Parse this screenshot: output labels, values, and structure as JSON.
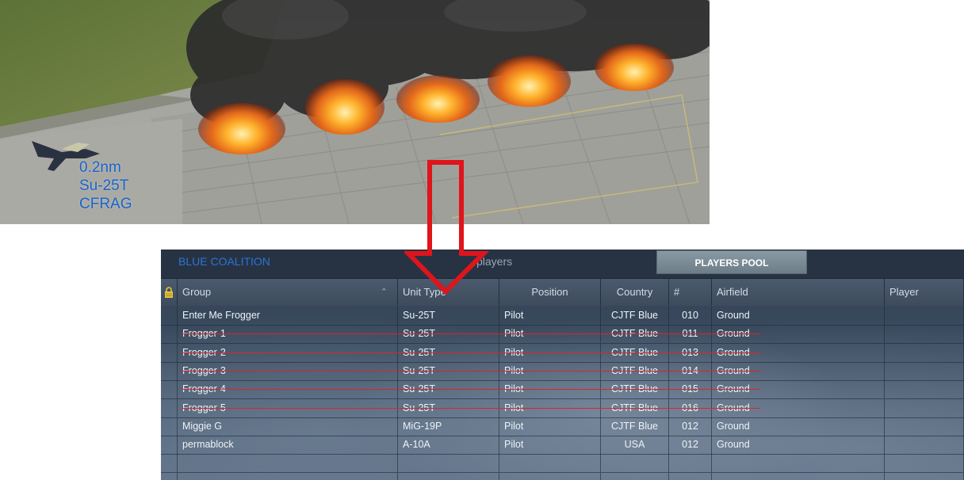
{
  "scene": {
    "unit_label": {
      "distance": "0.2nm",
      "type": "Su-25T",
      "group": "CFRAG"
    }
  },
  "panel": {
    "coalition": "BLUE COALITION",
    "players_count": "players",
    "players_pool_button": "PLAYERS POOL",
    "columns": [
      "Group",
      "Unit Type",
      "Position",
      "Country",
      "#",
      "Airfield",
      "Player"
    ],
    "rows": [
      {
        "group": "Enter Me Frogger",
        "unit_type": "Su-25T",
        "position": "Pilot",
        "country": "CJTF Blue",
        "number": "010",
        "airfield": "Ground",
        "player": "",
        "struck": false
      },
      {
        "group": "Frogger-1",
        "unit_type": "Su-25T",
        "position": "Pilot",
        "country": "CJTF Blue",
        "number": "011",
        "airfield": "Ground",
        "player": "",
        "struck": true
      },
      {
        "group": "Frogger-2",
        "unit_type": "Su-25T",
        "position": "Pilot",
        "country": "CJTF Blue",
        "number": "013",
        "airfield": "Ground",
        "player": "",
        "struck": true
      },
      {
        "group": "Frogger-3",
        "unit_type": "Su-25T",
        "position": "Pilot",
        "country": "CJTF Blue",
        "number": "014",
        "airfield": "Ground",
        "player": "",
        "struck": true
      },
      {
        "group": "Frogger-4",
        "unit_type": "Su-25T",
        "position": "Pilot",
        "country": "CJTF Blue",
        "number": "015",
        "airfield": "Ground",
        "player": "",
        "struck": true
      },
      {
        "group": "Frogger-5",
        "unit_type": "Su-25T",
        "position": "Pilot",
        "country": "CJTF Blue",
        "number": "016",
        "airfield": "Ground",
        "player": "",
        "struck": true
      },
      {
        "group": "Miggie G",
        "unit_type": "MiG-19P",
        "position": "Pilot",
        "country": "CJTF Blue",
        "number": "012",
        "airfield": "Ground",
        "player": "",
        "struck": false
      },
      {
        "group": "permablock",
        "unit_type": "A-10A",
        "position": "Pilot",
        "country": "USA",
        "number": "012",
        "airfield": "Ground",
        "player": "",
        "struck": false
      }
    ]
  },
  "colors": {
    "coalition_blue": "#2b73d6",
    "unit_label_blue": "#1a63c9",
    "arrow_red": "#e0141b",
    "strike_red": "#d8262a"
  },
  "icons": [
    "lock-icon",
    "sort-chevron-icon",
    "aircraft-icon"
  ]
}
